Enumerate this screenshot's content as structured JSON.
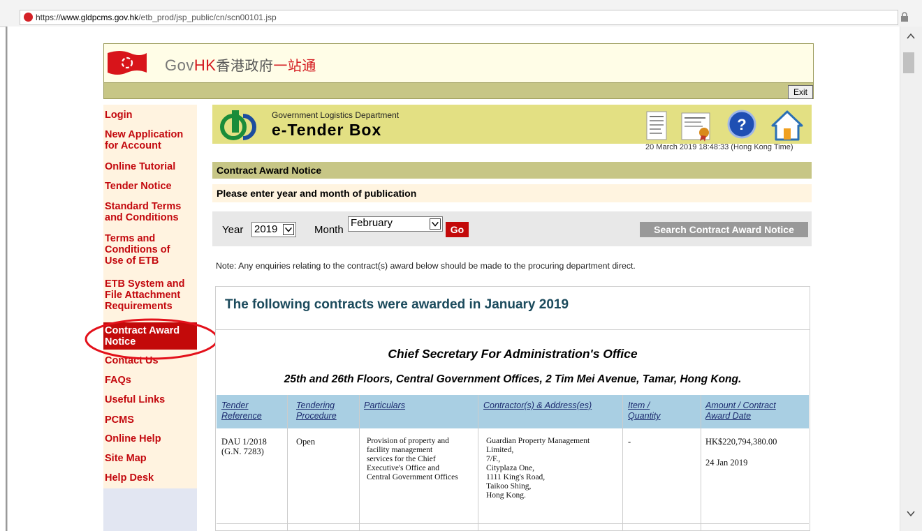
{
  "browser": {
    "url_scheme": "https://",
    "url_host": "www.gldpcms.gov.hk",
    "url_path": "/etb_prod/jsp_public/cn/scn00101.jsp"
  },
  "header": {
    "logo_text_a": "Gov",
    "logo_text_b": "HK",
    "logo_text_c": "香港政府",
    "logo_text_d": "一站通",
    "exit_label": "Exit"
  },
  "sidebar": {
    "items": [
      {
        "label": "Login"
      },
      {
        "label": "New Application\n for Account"
      },
      {
        "label": "Online Tutorial"
      },
      {
        "label": "Tender Notice"
      },
      {
        "label": "Standard Terms\n and Conditions"
      },
      {
        "label": "Terms and\n Conditions of\n Use of ETB"
      },
      {
        "label": "ETB System and\n File Attachment\n Requirements"
      },
      {
        "label": "Contract Award\n Notice"
      },
      {
        "label": "Contact Us"
      },
      {
        "label": "FAQs"
      },
      {
        "label": "Useful Links"
      },
      {
        "label": "PCMS"
      },
      {
        "label": "Online Help"
      },
      {
        "label": "Site Map"
      },
      {
        "label": "Help Desk"
      }
    ],
    "active_index": 7
  },
  "banner": {
    "department": "Government Logistics Department",
    "title": "e-Tender Box",
    "timestamp": "20 March 2019 18:48:33 (Hong Kong Time)"
  },
  "page": {
    "section_title": "Contract Award Notice",
    "prompt": "Please enter year and month of publication",
    "year_label": "Year",
    "year_value": "2019",
    "month_label": "Month",
    "month_value": "February",
    "go_label": "Go",
    "search_label": "Search Contract Award Notice",
    "note": "Note: Any enquiries relating to the contract(s) award below should be made to the procuring department direct."
  },
  "results": {
    "heading": "The following contracts were awarded in January 2019",
    "department": "Chief Secretary For Administration's Office",
    "address": "25th and 26th Floors, Central Government Offices, 2 Tim Mei Avenue, Tamar, Hong Kong.",
    "columns": [
      "Tender\nReference",
      "Tendering\nProcedure",
      "Particulars",
      "Contractor(s) & Address(es)",
      "Item /\nQuantity",
      "Amount / Contract\nAward Date"
    ],
    "rows": [
      {
        "reference": "DAU 1/2018\n(G.N. 7283)",
        "procedure": "Open",
        "particulars": "Provision of property and\nfacility management\nservices for the Chief\nExecutive's Office and\nCentral Government Offices",
        "contractor": "Guardian Property Management\nLimited,\n7/F.,\nCityplaza One,\n1111 King's Road,\nTaikoo Shing,\nHong Kong.",
        "quantity": "-",
        "amount": "HK$220,794,380.00",
        "award_date": "24 Jan 2019"
      }
    ]
  },
  "colors": {
    "nav_red": "#c3080e",
    "banner_olive": "#c7c686",
    "table_header_blue": "#a9cfe3",
    "highlight_ellipse": "#e3101a"
  }
}
